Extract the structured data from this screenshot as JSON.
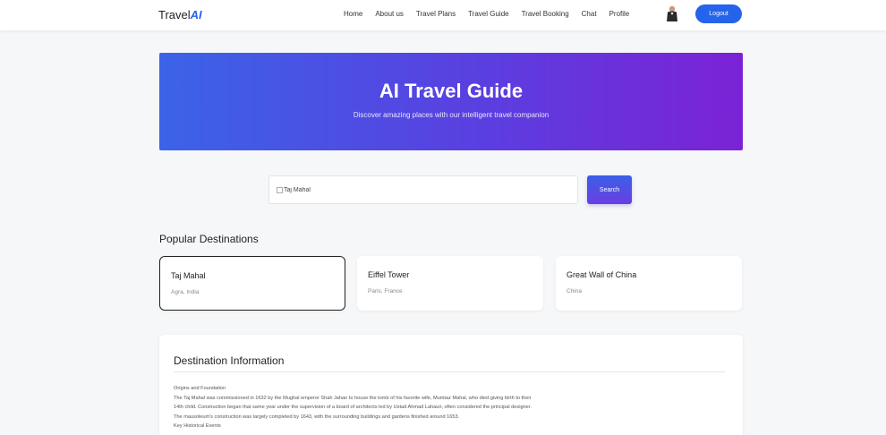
{
  "brand": {
    "prefix": "Travel",
    "suffix": "AI"
  },
  "nav": {
    "links": [
      "Home",
      "About us",
      "Travel Plans",
      "Travel Guide",
      "Travel Booking",
      "Chat",
      "Profile"
    ],
    "logout_label": "Logout"
  },
  "hero": {
    "title": "AI Travel Guide",
    "subtitle": "Discover amazing places with our intelligent travel companion"
  },
  "search": {
    "value": "Taj Mahal",
    "button_label": "Search"
  },
  "popular": {
    "title": "Popular Destinations",
    "items": [
      {
        "name": "Taj Mahal",
        "location": "Agra, India"
      },
      {
        "name": "Eiffel Tower",
        "location": "Paris, France"
      },
      {
        "name": "Great Wall of China",
        "location": "China"
      }
    ]
  },
  "info": {
    "title": "Destination Information",
    "lines": [
      "Origins and Foundation",
      "The Taj Mahal was commissioned in 1632 by the Mughal emperor Shah Jahan to house the tomb of his favorite wife, Mumtaz Mahal, who died giving birth to their",
      "14th child. Construction began that same year under the supervision of a board of architects led by Ustad Ahmad Lahauri, often considered the principal designer.",
      "The mausoleum's construction was largely completed by 1643, with the surrounding buildings and gardens finished around 1653.",
      "Key Historical Events"
    ]
  },
  "colors": {
    "accent": "#2563eb",
    "hero_start": "#3b63e8",
    "hero_end": "#7c22d6"
  }
}
